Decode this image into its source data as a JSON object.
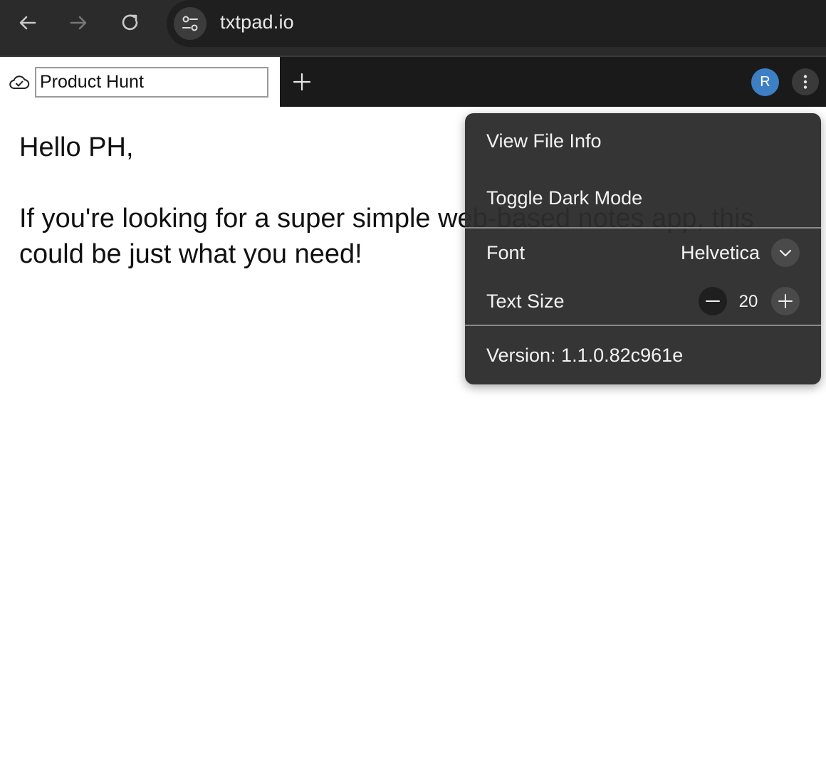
{
  "browser": {
    "url": "txtpad.io",
    "icons": [
      "back-arrow-icon",
      "forward-arrow-icon",
      "reload-icon",
      "site-settings-icon"
    ]
  },
  "header": {
    "document_title": "Product Hunt",
    "sync_status_icon": "cloud-check-icon",
    "new_tab_icon": "plus-icon",
    "avatar_initial": "R",
    "avatar_color": "#3d7fc4",
    "menu_icon": "vertical-dots-icon"
  },
  "editor": {
    "line1": "Hello PH,",
    "line2": "If you're looking for a super simple web-based notes app, this",
    "line3": "could be just what you need!"
  },
  "menu": {
    "view_file_info": "View File Info",
    "toggle_dark_mode": "Toggle Dark Mode",
    "font_label": "Font",
    "font_value": "Helvetica",
    "text_size_label": "Text Size",
    "text_size_value": "20",
    "version": "Version: 1.1.0.82c961e"
  },
  "colors": {
    "chrome_bg": "#2b2b2b",
    "header_dark_bg": "#1a1a1a",
    "menu_bg": "#2d2d2d"
  }
}
